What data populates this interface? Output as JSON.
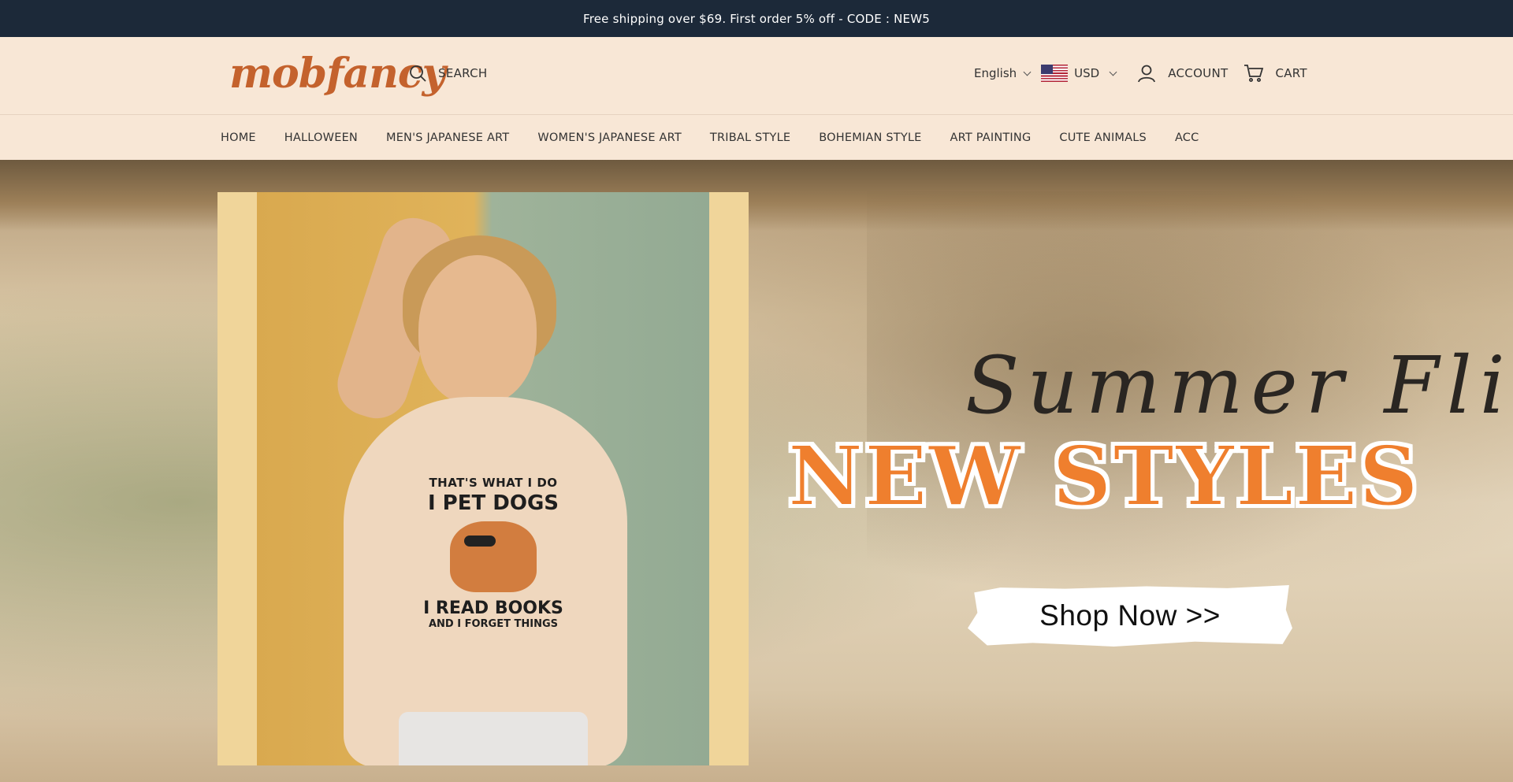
{
  "announcement": {
    "text": "Free shipping over $69. First order 5% off - CODE : NEW5"
  },
  "header": {
    "logo": "mobfancy",
    "search_label": "SEARCH",
    "language": "English",
    "currency": "USD",
    "account_label": "ACCOUNT",
    "cart_label": "CART"
  },
  "nav": {
    "items": [
      {
        "label": "HOME"
      },
      {
        "label": "HALLOWEEN"
      },
      {
        "label": "MEN'S JAPANESE ART"
      },
      {
        "label": "WOMEN'S JAPANESE ART"
      },
      {
        "label": "TRIBAL STYLE"
      },
      {
        "label": "BOHEMIAN STYLE"
      },
      {
        "label": "ART PAINTING"
      },
      {
        "label": "CUTE ANIMALS"
      },
      {
        "label": "ACC"
      }
    ]
  },
  "hero": {
    "script_title": "Summer Fling",
    "headline": "NEW STYLES",
    "cta_label": "Shop Now >>",
    "tee_lines": [
      "THAT'S WHAT I DO",
      "I PET DOGS",
      "I READ BOOKS",
      "AND I FORGET THINGS"
    ]
  },
  "colors": {
    "announcement_bg": "#1c2939",
    "header_bg": "#f8e7d6",
    "logo": "#c4622d",
    "headline": "#ef7f2e"
  },
  "icons": [
    "search-icon",
    "chevron-down-icon",
    "us-flag-icon",
    "user-icon",
    "cart-icon"
  ]
}
